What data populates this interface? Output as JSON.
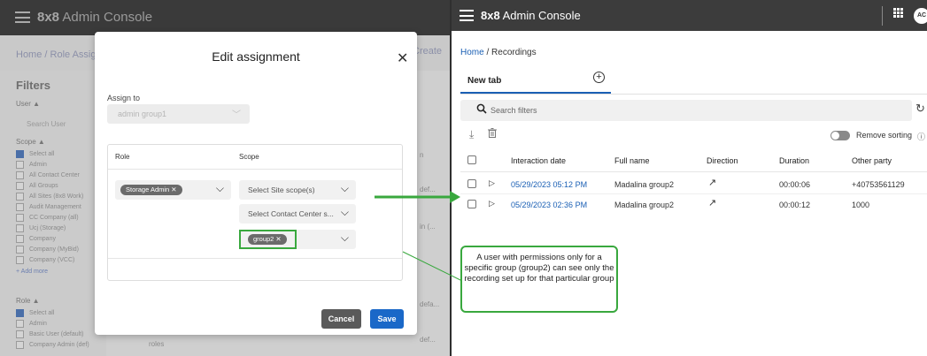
{
  "left": {
    "brand_strong": "8x8",
    "brand_rest": " Admin Console",
    "breadcrumb": "Home / Role Assig",
    "create_label": "Create",
    "filters_title": "Filters",
    "user_label": "User ▲",
    "search_user_placeholder": "Search User",
    "scope_label": "Scope ▲",
    "scope_items": [
      "Select all",
      "Admin",
      "All Contact Center",
      "All Groups",
      "All Sites (8x8 Work)",
      "Audit Management",
      "CC Company (all)",
      "Ucj (Storage)",
      "Company",
      "Company (MyBid)",
      "Company (VCC)"
    ],
    "add_more": "+ Add more",
    "role_label": "Role ▲",
    "role_items": [
      "Select all",
      "Admin",
      "Basic User (default)",
      "Company Admin (def)"
    ],
    "bg_cells": [
      "n",
      "def...",
      "in (...",
      "defa...",
      "def...",
      "roles"
    ]
  },
  "modal": {
    "title": "Edit assignment",
    "close": "✕",
    "assign_label": "Assign to",
    "assign_value": "admin group1",
    "col_role": "Role",
    "col_scope": "Scope",
    "role_chip": "Storage Admin ✕",
    "site_placeholder": "Select Site scope(s)",
    "cc_placeholder": "Select Contact Center s...",
    "group_chip": "group2 ✕",
    "cancel": "Cancel",
    "save": "Save"
  },
  "right": {
    "brand_strong": "8x8",
    "brand_rest": " Admin Console",
    "avatar": "AC",
    "crumb_home": "Home",
    "crumb_sep": " / ",
    "crumb_current": "Recordings",
    "tab": "New tab",
    "search_placeholder": "Search filters",
    "remove_sorting": "Remove sorting",
    "columns": [
      "Interaction date",
      "Full name",
      "Direction",
      "Duration",
      "Other party"
    ],
    "rows": [
      {
        "date": "05/29/2023 05:12 PM",
        "name": "Madalina group2",
        "duration": "00:00:06",
        "other": "+40753561129"
      },
      {
        "date": "05/29/2023 02:36 PM",
        "name": "Madalina group2",
        "duration": "00:00:12",
        "other": "1000"
      }
    ]
  },
  "callout": "A user with permissions only for a specific group (group2) can see only the recording set up for that particular group",
  "colors": {
    "accent_green": "#39a83e",
    "link_blue": "#1a5fb4",
    "save_blue": "#1a68c8"
  }
}
